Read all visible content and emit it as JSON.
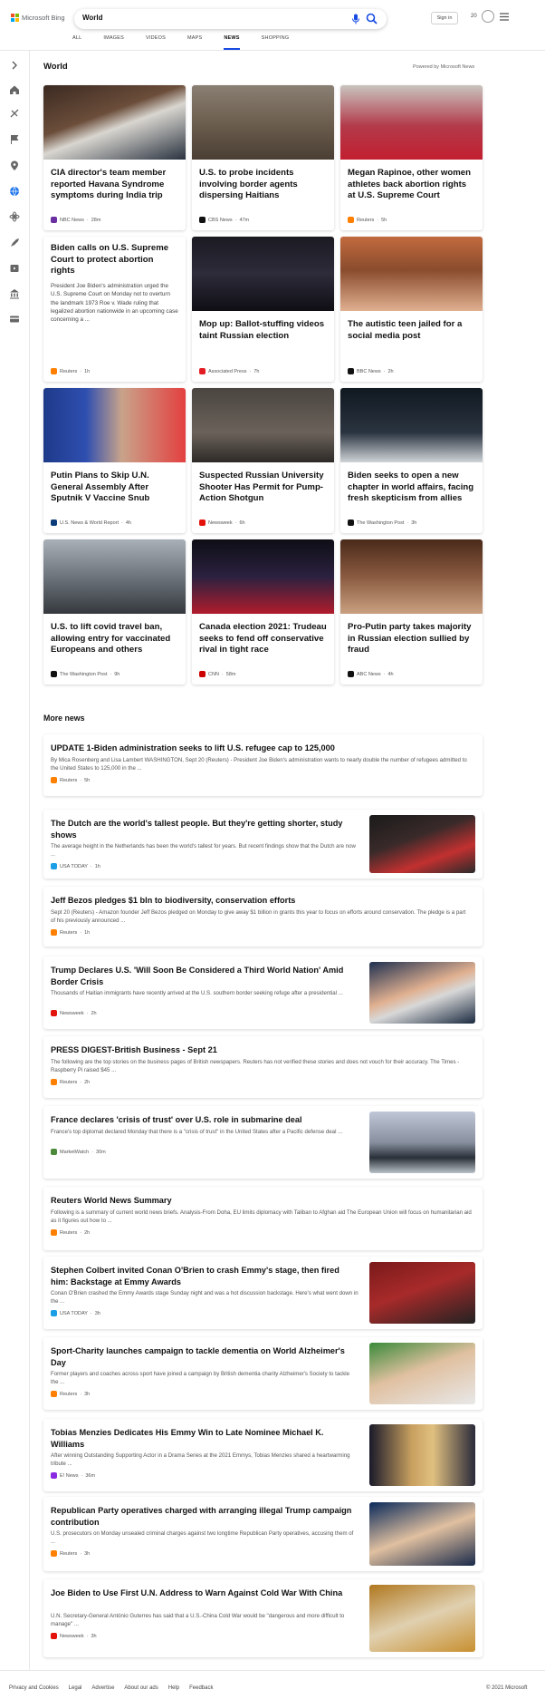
{
  "header": {
    "brand": "Microsoft Bing",
    "query": "World",
    "signin": "Sign in",
    "points": "20",
    "tabs": [
      "ALL",
      "IMAGES",
      "VIDEOS",
      "MAPS",
      "NEWS",
      "SHOPPING"
    ],
    "active_tab": "NEWS"
  },
  "section_title": "World",
  "powered_by": "Powered by Microsoft News",
  "cards": [
    {
      "title": "CIA director's team member reported Havana Syndrome symptoms during India trip",
      "source": "NBC News",
      "age": "28m"
    },
    {
      "title": "U.S. to probe incidents involving border agents dispersing Haitians",
      "source": "CBS News",
      "age": "47m"
    },
    {
      "title": "Megan Rapinoe, other women athletes back abortion rights at U.S. Supreme Court",
      "source": "Reuters",
      "age": "5h"
    },
    {
      "title": "Biden calls on U.S. Supreme Court to protect abortion rights",
      "desc": "President Joe Biden's administration urged the U.S. Supreme Court on Monday not to overturn the landmark 1973 Roe v. Wade ruling that legalized abortion nationwide in an upcoming case concerning a ...",
      "source": "Reuters",
      "age": "1h"
    },
    {
      "title": "Mop up: Ballot-stuffing videos taint Russian election",
      "source": "Associated Press",
      "age": "7h"
    },
    {
      "title": "The autistic teen jailed for a social media post",
      "source": "BBC News",
      "age": "2h"
    },
    {
      "title": "Putin Plans to Skip U.N. General Assembly After Sputnik V Vaccine Snub",
      "source": "U.S. News & World Report",
      "age": "4h"
    },
    {
      "title": "Suspected Russian University Shooter Has Permit for Pump-Action Shotgun",
      "source": "Newsweek",
      "age": "6h"
    },
    {
      "title": "Biden seeks to open a new chapter in world affairs, facing fresh skepticism from allies",
      "source": "The Washington Post",
      "age": "3h"
    },
    {
      "title": "U.S. to lift covid travel ban, allowing entry for vaccinated Europeans and others",
      "source": "The Washington Post",
      "age": "9h"
    },
    {
      "title": "Canada election 2021: Trudeau seeks to fend off conservative rival in tight race",
      "source": "CNN",
      "age": "58m"
    },
    {
      "title": "Pro-Putin party takes majority in Russian election sullied by fraud",
      "source": "ABC News",
      "age": "4h"
    }
  ],
  "more_title": "More news",
  "more": [
    {
      "title": "UPDATE 1-Biden administration seeks to lift U.S. refugee cap to 125,000",
      "desc": "By Mica Rosenberg and Lisa Lambert WASHINGTON, Sept 20 (Reuters) - President Joe Biden's administration wants to nearly double the number of refugees admitted to the United States to 125,000 in the ...",
      "source": "Reuters",
      "age": "5h"
    },
    {
      "title": "The Dutch are the world's tallest people. But they're getting shorter, study shows",
      "desc": "The average height in the Netherlands has been the world's tallest for years. But recent findings show that the Dutch are now ...",
      "source": "USA TODAY",
      "age": "1h"
    },
    {
      "title": "Jeff Bezos pledges $1 bln to biodiversity, conservation efforts",
      "desc": "Sept 20 (Reuters) - Amazon founder Jeff Bezos pledged on Monday to give away $1 billion in grants this year to focus on efforts around conservation. The pledge is a part of his previously announced ...",
      "source": "Reuters",
      "age": "1h"
    },
    {
      "title": "Trump Declares U.S. 'Will Soon Be Considered a Third World Nation' Amid Border Crisis",
      "desc": "Thousands of Haitian immigrants have recently arrived at the U.S. southern border seeking refuge after a presidential ...",
      "source": "Newsweek",
      "age": "2h"
    },
    {
      "title": "PRESS DIGEST-British Business - Sept 21",
      "desc": "The following are the top stories on the business pages of British newspapers. Reuters has not verified these stories and does not vouch for their accuracy. The Times - Raspberry Pi raised $45 ...",
      "source": "Reuters",
      "age": "2h"
    },
    {
      "title": "France declares 'crisis of trust' over U.S. role in submarine deal",
      "desc": "France's top diplomat declared Monday that there is a \"crisis of trust\" in the United States after a Pacific defense deal ...",
      "source": "MarketWatch",
      "age": "30m"
    },
    {
      "title": "Reuters World News Summary",
      "desc": "Following is a summary of current world news briefs. Analysis-From Doha, EU limits diplomacy with Taliban to Afghan aid The European Union will focus on humanitarian aid as it figures out how to ...",
      "source": "Reuters",
      "age": "2h"
    },
    {
      "title": "Stephen Colbert invited Conan O'Brien to crash Emmy's stage, then fired him: Backstage at Emmy Awards",
      "desc": "Conan O'Brien crashed the Emmy Awards stage Sunday night and was a hot discussion backstage. Here's what went down in the ...",
      "source": "USA TODAY",
      "age": "3h"
    },
    {
      "title": "Sport-Charity launches campaign to tackle dementia on World Alzheimer's Day",
      "desc": "Former players and coaches across sport have joined a campaign by British dementia charity Alzheimer's Society to tackle the ...",
      "source": "Reuters",
      "age": "3h"
    },
    {
      "title": "Tobias Menzies Dedicates His Emmy Win to Late Nominee Michael K. Williams",
      "desc": "After winning Outstanding Supporting Actor in a Drama Series at the 2021 Emmys, Tobias Menzies shared a heartwarming tribute ...",
      "source": "E! News",
      "age": "36m"
    },
    {
      "title": "Republican Party operatives charged with arranging illegal Trump campaign contribution",
      "desc": "U.S. prosecutors on Monday unsealed criminal charges against two longtime Republican Party operatives, accusing them of ...",
      "source": "Reuters",
      "age": "3h"
    },
    {
      "title": "Joe Biden to Use First U.N. Address to Warn Against Cold War With China",
      "desc": "U.N. Secretary-General António Guterres has said that a U.S.-China Cold War would be \"dangerous and more difficult to manage\" ...",
      "source": "Newsweek",
      "age": "3h"
    }
  ],
  "footer": {
    "links": [
      "Privacy and Cookies",
      "Legal",
      "Advertise",
      "About our ads",
      "Help",
      "Feedback"
    ],
    "copyright": "© 2021 Microsoft"
  },
  "colors": {
    "accent": "#174ae4",
    "reuters": "#ff8000",
    "newsweek": "#e3120b"
  }
}
